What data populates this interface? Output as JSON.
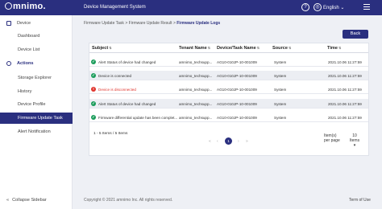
{
  "header": {
    "logo_text": "mnimo.",
    "system_name": "Device Management System",
    "language": "English",
    "icons": [
      "help-icon",
      "globe-icon",
      "menu-icon"
    ]
  },
  "sidebar": {
    "items": [
      {
        "label": "Device",
        "type": "section",
        "icon": "device-icon"
      },
      {
        "label": "Dashboard"
      },
      {
        "label": "Device List"
      },
      {
        "label": "Actions",
        "type": "section",
        "icon": "actions-icon"
      },
      {
        "label": "Storage Explorer"
      },
      {
        "label": "History"
      },
      {
        "label": "Device Profile"
      },
      {
        "label": "Firmware Update Task",
        "active": true
      },
      {
        "label": "Alert Notification"
      }
    ],
    "collapse_label": "Collapse Sidebar"
  },
  "breadcrumb": {
    "items": [
      "Firmware Update Task",
      "Firmware Update Result",
      "Firmware Update Logs"
    ],
    "separator": ">"
  },
  "back_button": "Back",
  "table": {
    "columns": [
      "Subject",
      "Tenant Name",
      "Device/Task Name",
      "Source",
      "Time"
    ],
    "rows": [
      {
        "status": "ok",
        "subject": "Alert Status of device had changed",
        "tenant": "amnimo_techsupp...",
        "device": "AG10-010JP-10-001009",
        "source": "System",
        "time": "2021.10.06 11:27:59"
      },
      {
        "status": "ok",
        "subject": "Device is connected",
        "tenant": "amnimo_techsupp...",
        "device": "AG10-010JP-10-001009",
        "source": "System",
        "time": "2021.10.06 11:27:59"
      },
      {
        "status": "err",
        "subject": "Device is disconnected",
        "tenant": "amnimo_techsupp...",
        "device": "AG10-010JP-10-001009",
        "source": "System",
        "time": "2021.10.06 11:27:59"
      },
      {
        "status": "ok",
        "subject": "Alert Status of device had changed",
        "tenant": "amnimo_techsupp...",
        "device": "AG10-010JP-10-001009",
        "source": "System",
        "time": "2021.10.06 11:27:59"
      },
      {
        "status": "ok",
        "subject": "Firmware differential update has been complet...",
        "tenant": "amnimo_techsupp...",
        "device": "AG10-010JP-10-001009",
        "source": "System",
        "time": "2021.10.06 11:27:59"
      }
    ]
  },
  "pagination": {
    "summary": "1 - 5 Items / 5 Items",
    "current_page": "1",
    "items_per_page_label": "Item(s) per page",
    "items_per_page_value": "10 Items"
  },
  "footer": {
    "copyright": "Copyright © 2021 amnimo Inc. All rights reserved.",
    "terms": "Term of Use"
  },
  "colors": {
    "brand": "#2a2f7f",
    "success": "#1a9c5a",
    "error": "#e0342c"
  }
}
